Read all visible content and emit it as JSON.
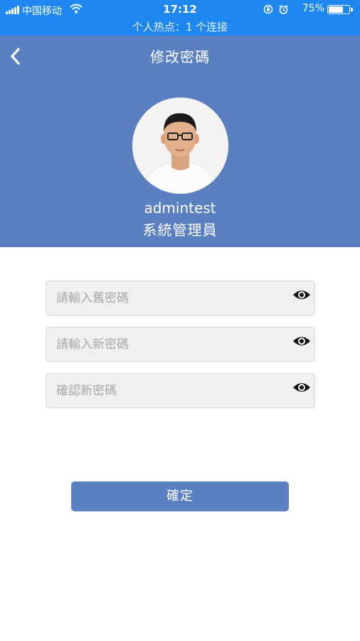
{
  "status_bar": {
    "carrier": "中国移动",
    "time": "17:12",
    "battery": "75%",
    "battery_level": 0.75,
    "hotspot": "个人热点：1 个连接",
    "icons": [
      "signal-icon",
      "wifi-icon",
      "orientation-lock-icon",
      "alarm-icon",
      "battery-icon"
    ]
  },
  "header": {
    "title": "修改密碼",
    "back_icon": "chevron-left-icon"
  },
  "profile": {
    "username": "admintest",
    "role": "系統管理員"
  },
  "form": {
    "old_password_placeholder": "請輸入舊密碼",
    "new_password_placeholder": "請輸入新密碼",
    "confirm_password_placeholder": "確認新密碼",
    "toggle_icon": "eye-icon"
  },
  "confirm_label": "確定",
  "colors": {
    "status_bar": "#1e88f0",
    "header": "#5b80c2",
    "button": "#5b80c2",
    "field_bg": "#f0f0f0"
  }
}
